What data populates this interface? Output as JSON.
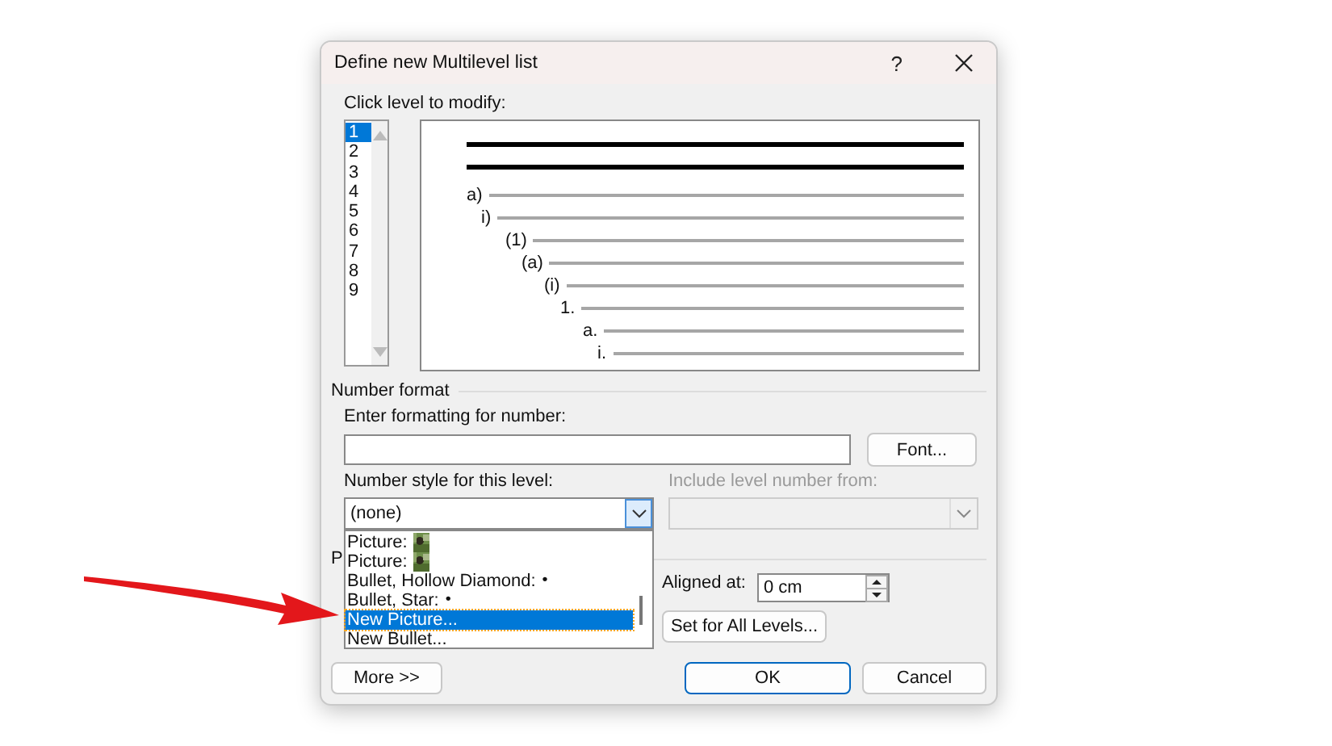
{
  "dialog": {
    "title": "Define new Multilevel list",
    "help": "?"
  },
  "levels": {
    "label": "Click level to modify:",
    "items": [
      {
        "label": "1",
        "selected": true
      },
      {
        "label": "2",
        "selected": false
      },
      {
        "label": "3",
        "selected": false
      },
      {
        "label": "4",
        "selected": false
      },
      {
        "label": "5",
        "selected": false
      },
      {
        "label": "6",
        "selected": false
      },
      {
        "label": "7",
        "selected": false
      },
      {
        "label": "8",
        "selected": false
      },
      {
        "label": "9",
        "selected": false
      }
    ]
  },
  "preview": {
    "rows": [
      {
        "label": "a)"
      },
      {
        "label": "i)"
      },
      {
        "label": "(1)"
      },
      {
        "label": "(a)"
      },
      {
        "label": "(i)"
      },
      {
        "label": "1."
      },
      {
        "label": "a."
      },
      {
        "label": "i."
      }
    ]
  },
  "number_format": {
    "title": "Number format",
    "format_label": "Enter formatting for number:",
    "font_button": "Font...",
    "style_label": "Number style for this level:",
    "style_value": "(none)",
    "include_label": "Include level number from:",
    "include_disabled": true,
    "style_options": [
      {
        "label": "Picture:",
        "kind": "picture",
        "selected": false
      },
      {
        "label": "Picture:",
        "kind": "picture",
        "selected": false
      },
      {
        "label": "Bullet, Hollow Diamond:",
        "kind": "bullet",
        "symbol": "•",
        "selected": false
      },
      {
        "label": "Bullet, Star:",
        "kind": "bullet",
        "symbol": "•",
        "selected": false
      },
      {
        "label": "New Picture...",
        "kind": "text",
        "selected": true
      },
      {
        "label": "New Bullet...",
        "kind": "text",
        "selected": false
      }
    ]
  },
  "position": {
    "title": "P",
    "aligned_label": "Aligned at:",
    "aligned_value": "0 cm",
    "set_all_button": "Set for All Levels..."
  },
  "buttons": {
    "more": "More >>",
    "ok": "OK",
    "cancel": "Cancel"
  }
}
